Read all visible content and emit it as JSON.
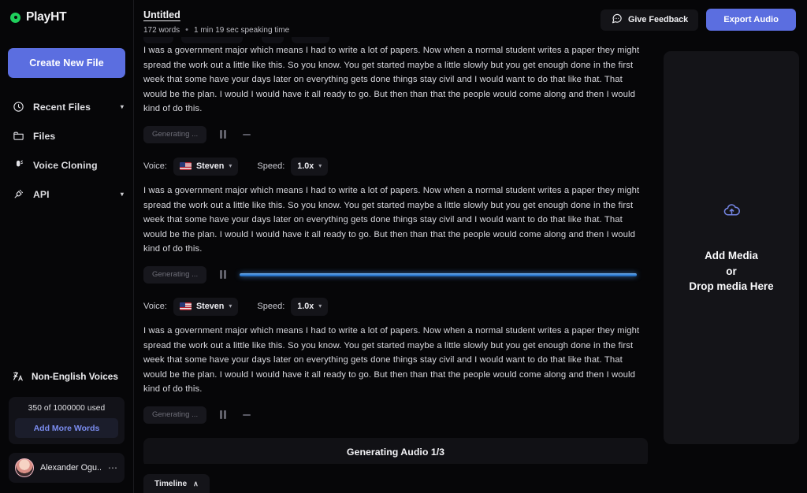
{
  "brand": {
    "name": "PlayHT",
    "logo_icon": "play-circle-icon"
  },
  "sidebar": {
    "create_button": "Create New File",
    "items": [
      {
        "label": "Recent Files",
        "icon": "clock-icon",
        "caret": "▾",
        "has_caret": true
      },
      {
        "label": "Files",
        "icon": "folder-icon",
        "has_caret": false
      },
      {
        "label": "Voice Cloning",
        "icon": "microphone-icon",
        "has_caret": false
      },
      {
        "label": "API",
        "icon": "plug-icon",
        "caret": "▾",
        "has_caret": true
      }
    ],
    "non_english": {
      "label": "Non-English Voices",
      "icon": "translate-icon"
    },
    "usage": {
      "text": "350 of 1000000 used",
      "add_words_button": "Add More Words",
      "used": 350,
      "total": 1000000
    },
    "user": {
      "name": "Alexander Ogu...",
      "menu_icon": "more-horizontal-icon",
      "avatar_icon": "avatar"
    }
  },
  "header": {
    "title": "Untitled",
    "word_count": "172 words",
    "separator": "•",
    "speaking_time": "1 min 19 sec speaking time",
    "feedback_button": "Give Feedback",
    "feedback_icon": "chat-bubble-icon",
    "export_button": "Export Audio"
  },
  "editor": {
    "paragraph": "I was a government major which means I had to write a lot of papers. Now when a normal student writes a paper they might spread the work out a little like this. So you know. You get started maybe a little slowly but you get enough done in the first week that some have your days later on everything gets done things stay civil and I would want to do that like that. That would be the plan. I would I would have it all ready to go. But then than that the people would come along and then I would kind of do this.",
    "blocks": [
      {
        "status_label": "Generating ...",
        "pause_icon": "pause-icon",
        "trailing_icon": "dash-icon",
        "progress_percent": 0,
        "show_progress": false
      },
      {
        "status_label": "Generating ...",
        "pause_icon": "pause-icon",
        "trailing_icon": "progress-bar",
        "progress_percent": 100,
        "show_progress": true
      },
      {
        "status_label": "Generating ...",
        "pause_icon": "pause-icon",
        "trailing_icon": "dash-icon",
        "progress_percent": 0,
        "show_progress": false
      }
    ],
    "voice_rows": [
      {
        "voice_label": "Voice:",
        "voice_value": "Steven",
        "voice_flag": "us-flag",
        "speed_label": "Speed:",
        "speed_value": "1.0x",
        "caret": "▾"
      },
      {
        "voice_label": "Voice:",
        "voice_value": "Steven",
        "voice_flag": "us-flag",
        "speed_label": "Speed:",
        "speed_value": "1.0x",
        "caret": "▾"
      }
    ],
    "generating_banner": "Generating Audio 1/3",
    "timeline": {
      "label": "Timeline",
      "caret": "∧"
    }
  },
  "media_panel": {
    "icon": "cloud-upload-icon",
    "title": "Add Media",
    "or": "or",
    "subtitle": "Drop media Here"
  },
  "colors": {
    "accent": "#5b6ee0",
    "brand_green": "#1fcf5c",
    "progress_blue": "#2f7fd6",
    "link_blue": "#7b8df0",
    "background": "#060608",
    "panel": "#141418"
  }
}
